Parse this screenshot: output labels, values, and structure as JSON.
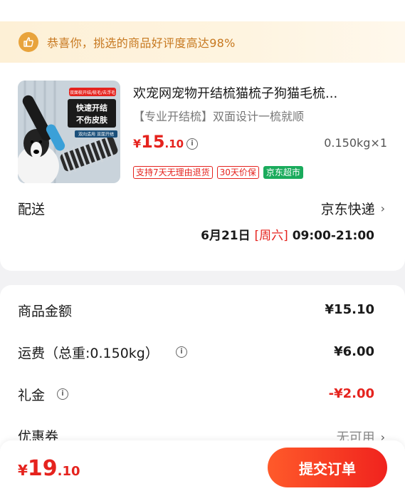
{
  "banner": {
    "text": "恭喜你，挑选的商品好评度高达98%",
    "icon": "thumbs-up-icon"
  },
  "product": {
    "title": "欢宠网宠物开结梳猫梳子狗猫毛梳...",
    "subtitle": "【专业开结梳】双面设计一梳就顺",
    "price_yen": "¥",
    "price_int": "15",
    "price_dec": ".10",
    "qty": "0.150kg×1",
    "tags": [
      "支持7天无理由退货",
      "30天价保",
      "京东超市"
    ],
    "image_texts": {
      "badge": "双面梳开结/梳毛/去浮毛",
      "line1": "快速开结",
      "line2": "不伤皮肤",
      "footer": "双向适用 双面开结"
    }
  },
  "shipping": {
    "label": "配送",
    "carrier": "京东快递",
    "date": "6月21日",
    "weekday": "[周六]",
    "time": "09:00-21:00"
  },
  "summary": {
    "items": [
      {
        "label": "商品金额",
        "value": "¥15.10"
      },
      {
        "label": "运费（总重:0.150kg）",
        "value": "¥6.00"
      },
      {
        "label": "礼金",
        "value": "-¥2.00"
      },
      {
        "label": "优惠券",
        "value": "无可用"
      }
    ]
  },
  "footer": {
    "yen": "¥",
    "total_int": "19",
    "total_dec": ".10",
    "submit_label": "提交订单"
  },
  "colors": {
    "accent": "#e5231e",
    "banner": "#c7781f",
    "green": "#1aab5c"
  }
}
